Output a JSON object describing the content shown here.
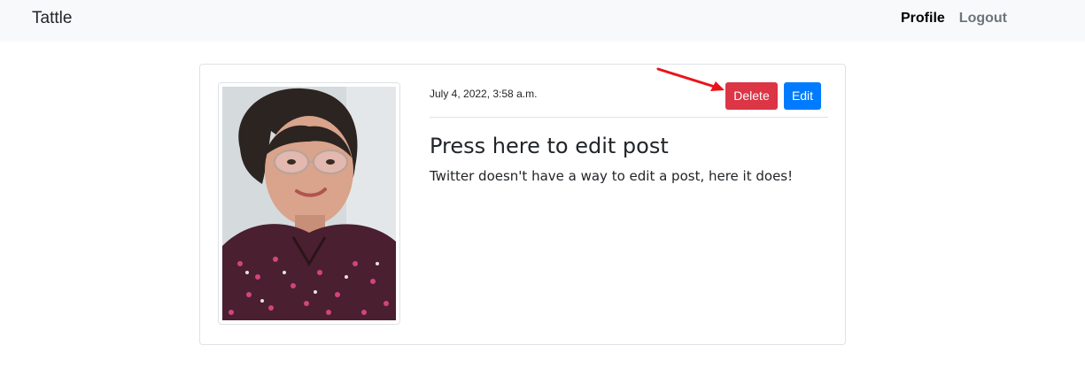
{
  "navbar": {
    "brand": "Tattle",
    "links": [
      {
        "label": "Profile"
      },
      {
        "label": "Logout"
      }
    ]
  },
  "post": {
    "date": "July 4, 2022, 3:58 a.m.",
    "delete_label": "Delete",
    "edit_label": "Edit",
    "title": "Press here to edit post",
    "body": "Twitter doesn't have a way to edit a post, here it does!"
  },
  "colors": {
    "navbar_bg": "#f8f9fa",
    "delete": "#dc3545",
    "edit": "#007bff",
    "annotation_arrow": "#e8141b"
  },
  "icons": {
    "annotation": "arrow-icon"
  }
}
